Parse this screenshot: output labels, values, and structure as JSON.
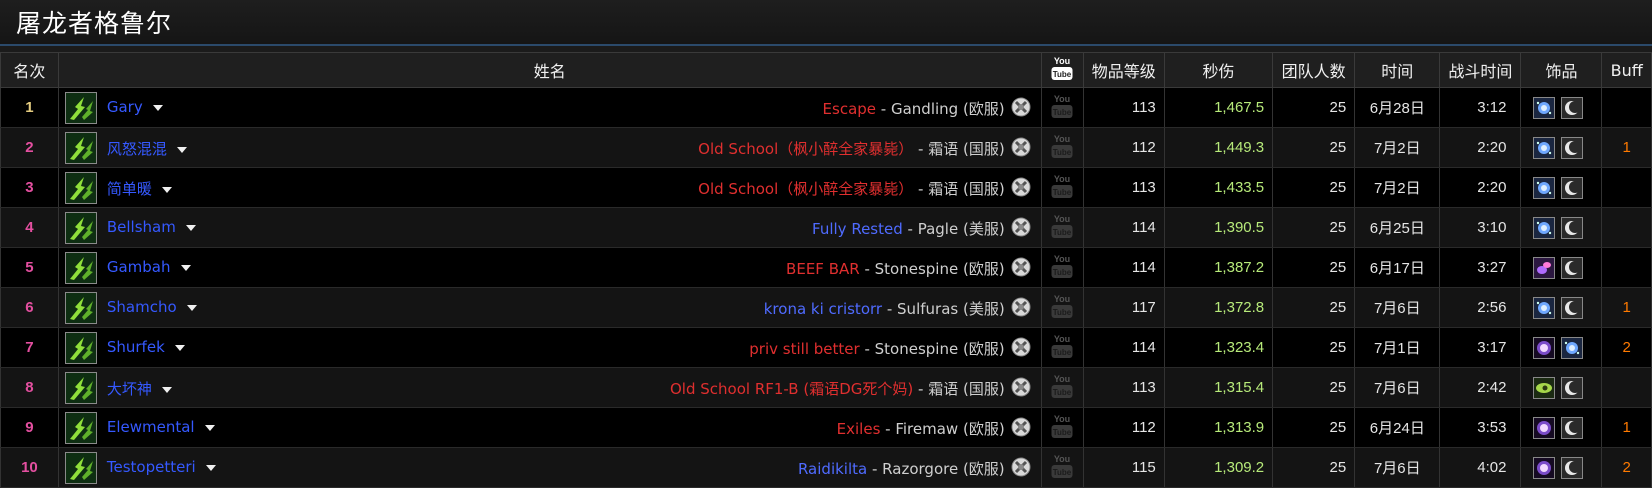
{
  "page_title": "屠龙者格鲁尔",
  "columns": {
    "rank": "名次",
    "name": "姓名",
    "ilvl": "物品等级",
    "dps": "秒伤",
    "raid_size": "团队人数",
    "date": "时间",
    "fight_time": "战斗时间",
    "trinkets": "饰品",
    "buff": "Buff"
  },
  "youtube_label_top": "You",
  "youtube_label_bottom": "Tube",
  "rows": [
    {
      "rank": "1",
      "name": "Gary",
      "guild": "Escape",
      "guild_color": "red",
      "server": "- Gandling (欧服)",
      "ilvl": "113",
      "dps": "1,467.5",
      "raid": "25",
      "date": "6月28日",
      "fight": "3:12",
      "buff": "",
      "trinkets": [
        "blue-orb-icon",
        "crescent-icon"
      ]
    },
    {
      "rank": "2",
      "name": "风怒混混",
      "guild": "Old School（枫小醉全家暴毙）",
      "guild_color": "red",
      "server": "- 霜语 (国服)",
      "ilvl": "112",
      "dps": "1,449.3",
      "raid": "25",
      "date": "7月2日",
      "fight": "2:20",
      "buff": "1",
      "trinkets": [
        "blue-orb-icon",
        "crescent-icon"
      ]
    },
    {
      "rank": "3",
      "name": "简单暖",
      "guild": "Old School（枫小醉全家暴毙）",
      "guild_color": "red",
      "server": "- 霜语 (国服)",
      "ilvl": "113",
      "dps": "1,433.5",
      "raid": "25",
      "date": "7月2日",
      "fight": "2:20",
      "buff": "",
      "trinkets": [
        "blue-orb-icon",
        "crescent-icon"
      ]
    },
    {
      "rank": "4",
      "name": "Bellsham",
      "guild": "Fully Rested",
      "guild_color": "blue",
      "server": "- Pagle (美服)",
      "ilvl": "114",
      "dps": "1,390.5",
      "raid": "25",
      "date": "6月25日",
      "fight": "3:10",
      "buff": "",
      "trinkets": [
        "blue-orb-icon",
        "crescent-icon"
      ]
    },
    {
      "rank": "5",
      "name": "Gambah",
      "guild": "BEEF BAR",
      "guild_color": "red",
      "server": "- Stonespine (欧服)",
      "ilvl": "114",
      "dps": "1,387.2",
      "raid": "25",
      "date": "6月17日",
      "fight": "3:27",
      "buff": "",
      "trinkets": [
        "purple-swirl-icon",
        "crescent-icon"
      ]
    },
    {
      "rank": "6",
      "name": "Shamcho",
      "guild": "krona ki cristorr",
      "guild_color": "blue",
      "server": "- Sulfuras (美服)",
      "ilvl": "117",
      "dps": "1,372.8",
      "raid": "25",
      "date": "7月6日",
      "fight": "2:56",
      "buff": "1",
      "trinkets": [
        "blue-orb-icon",
        "crescent-icon"
      ]
    },
    {
      "rank": "7",
      "name": "Shurfek",
      "guild": "priv still better",
      "guild_color": "red",
      "server": "- Stonespine (欧服)",
      "ilvl": "114",
      "dps": "1,323.4",
      "raid": "25",
      "date": "7月1日",
      "fight": "3:17",
      "buff": "2",
      "trinkets": [
        "pink-orb-icon",
        "blue-orb-icon"
      ]
    },
    {
      "rank": "8",
      "name": "大坏神",
      "guild": "Old School RF1-B (霜语DG死个妈)",
      "guild_color": "red",
      "server": "- 霜语 (国服)",
      "ilvl": "113",
      "dps": "1,315.4",
      "raid": "25",
      "date": "7月6日",
      "fight": "2:42",
      "buff": "",
      "trinkets": [
        "green-eye-icon",
        "crescent-icon"
      ]
    },
    {
      "rank": "9",
      "name": "Elewmental",
      "guild": "Exiles",
      "guild_color": "red",
      "server": "- Firemaw (欧服)",
      "ilvl": "112",
      "dps": "1,313.9",
      "raid": "25",
      "date": "6月24日",
      "fight": "3:53",
      "buff": "1",
      "trinkets": [
        "pink-orb-icon",
        "crescent-icon"
      ]
    },
    {
      "rank": "10",
      "name": "Testopetteri",
      "guild": "Raidikilta",
      "guild_color": "blue",
      "server": "- Razorgore (欧服)",
      "ilvl": "115",
      "dps": "1,309.2",
      "raid": "25",
      "date": "7月6日",
      "fight": "4:02",
      "buff": "2",
      "trinkets": [
        "pink-orb-icon",
        "crescent-icon"
      ]
    }
  ]
}
